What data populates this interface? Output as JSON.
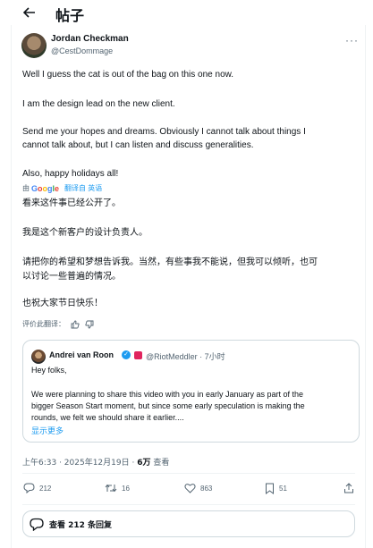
{
  "header": {
    "title": "帖子"
  },
  "post": {
    "author": {
      "name": "Jordan Checkman",
      "handle": "@CestDommage"
    },
    "paragraphs": [
      "Well I guess the cat is out of the bag on this one now.",
      "I am the design lead on the new client.",
      "Send me your hopes and dreams. Obviously I cannot talk about things I\ncannot talk about, but I can listen and discuss generalities.",
      "Also, happy holidays all!"
    ],
    "translation_bar": {
      "by": "由",
      "google": "Google",
      "label": "翻译自 英语"
    },
    "translated": [
      "看来这件事已经公开了。",
      "我是这个新客户的设计负责人。",
      "请把你的希望和梦想告诉我。当然，有些事我不能说，但我可以倾听，也可\n以讨论一些普遍的情况。",
      "也祝大家节日快乐！"
    ],
    "rate_label": "评价此翻译：",
    "quote": {
      "name": "Andrei van Roon",
      "handle_time": "@RiotMeddler · 7小时",
      "greeting": "Hey folks,",
      "body": "We were planning to share this video with you in early January as part of the\nbigger Season Start moment, but since some early speculation is making the\nrounds, we felt we should share it earlier....",
      "show_more": "显示更多"
    },
    "meta": {
      "timestamp": "上午6:33 · 2025年12月19日 · ",
      "views_count": "6万",
      "views_label": " 查看"
    },
    "actions": {
      "replies": "212",
      "retweets": "16",
      "likes": "863",
      "bookmarks": "51"
    },
    "view_replies": "查看 212 条回复"
  },
  "colors": {
    "accent": "#1d9bf0",
    "secondary_text": "#536471",
    "border": "#cfd9de"
  },
  "icons": [
    "back-arrow-icon",
    "more-icon",
    "verified-icon",
    "reply-icon",
    "retweet-icon",
    "like-icon",
    "bookmark-icon",
    "share-icon",
    "thumb-up-icon",
    "thumb-down-icon",
    "replies-bubble-icon"
  ]
}
